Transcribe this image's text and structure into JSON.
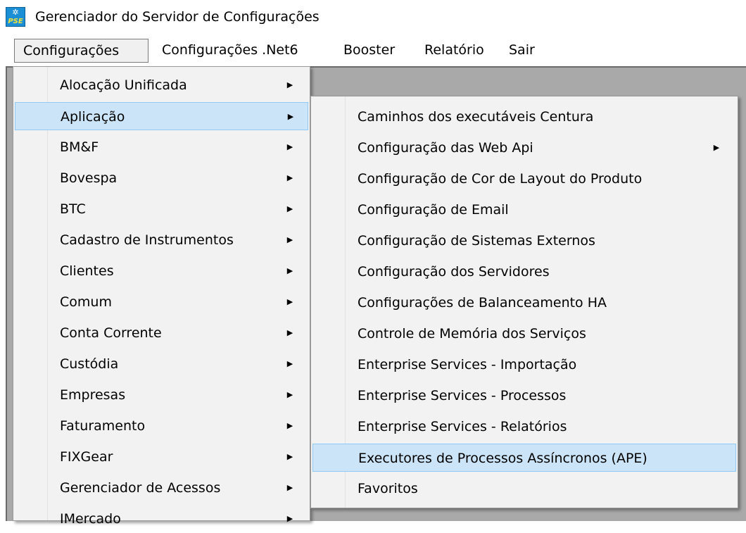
{
  "window": {
    "title": "Gerenciador do Servidor de Configurações",
    "icon": "pse-app-icon",
    "icon_text": "PSE"
  },
  "menubar": {
    "items": [
      {
        "label": "Configurações",
        "active": true
      },
      {
        "label": "Configurações .Net6",
        "active": false
      },
      {
        "label": "Booster",
        "active": false
      },
      {
        "label": "Relatório",
        "active": false
      },
      {
        "label": "Sair",
        "active": false
      }
    ]
  },
  "config_menu": {
    "items": [
      {
        "label": "Alocação Unificada",
        "submenu": true
      },
      {
        "label": "Aplicação",
        "submenu": true,
        "highlighted": true
      },
      {
        "label": "BM&F",
        "submenu": true
      },
      {
        "label": "Bovespa",
        "submenu": true
      },
      {
        "label": "BTC",
        "submenu": true
      },
      {
        "label": "Cadastro de Instrumentos",
        "submenu": true
      },
      {
        "label": "Clientes",
        "submenu": true
      },
      {
        "label": "Comum",
        "submenu": true
      },
      {
        "label": "Conta Corrente",
        "submenu": true
      },
      {
        "label": "Custódia",
        "submenu": true
      },
      {
        "label": "Empresas",
        "submenu": true
      },
      {
        "label": "Faturamento",
        "submenu": true
      },
      {
        "label": "FIXGear",
        "submenu": true
      },
      {
        "label": "Gerenciador de Acessos",
        "submenu": true
      },
      {
        "label": "IMercado",
        "submenu": true
      }
    ]
  },
  "aplicacao_menu": {
    "items": [
      {
        "label": "Caminhos dos executáveis Centura",
        "submenu": false
      },
      {
        "label": "Configuração das Web Api",
        "submenu": true
      },
      {
        "label": "Configuração de Cor de Layout do Produto",
        "submenu": false
      },
      {
        "label": "Configuração de Email",
        "submenu": false
      },
      {
        "label": "Configuração de Sistemas Externos",
        "submenu": false
      },
      {
        "label": "Configuração dos Servidores",
        "submenu": false
      },
      {
        "label": "Configurações de Balanceamento HA",
        "submenu": false
      },
      {
        "label": "Controle de Memória dos Serviços",
        "submenu": false
      },
      {
        "label": "Enterprise Services - Importação",
        "submenu": false
      },
      {
        "label": "Enterprise Services - Processos",
        "submenu": false
      },
      {
        "label": "Enterprise Services - Relatórios",
        "submenu": false
      },
      {
        "label": "Executores de Processos Assíncronos (APE)",
        "submenu": false,
        "highlighted": true
      },
      {
        "label": "Favoritos",
        "submenu": false
      }
    ]
  },
  "colors": {
    "menu_background": "#f2f2f2",
    "highlight_background": "#cce4f7",
    "highlight_border": "#90c8f6",
    "client_area": "#a9a9a9"
  },
  "icons": {
    "submenu_arrow": "submenu-arrow-icon",
    "arrow_glyph": "▶"
  }
}
